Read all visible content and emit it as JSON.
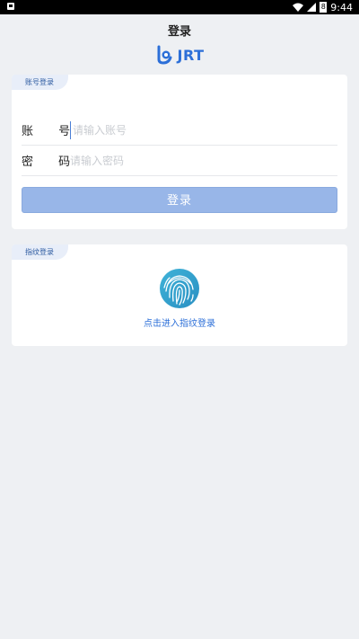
{
  "statusbar": {
    "time": "9:44",
    "battery": "8"
  },
  "header": {
    "title": "登录"
  },
  "logo": {
    "text": "JRT"
  },
  "account_login": {
    "tag": "账号登录",
    "account_label": "账 号",
    "account_placeholder": "请输入账号",
    "password_label": "密 码",
    "password_placeholder": "请输入密码",
    "login_button": "登录"
  },
  "fingerprint_login": {
    "tag": "指纹登录",
    "link_text": "点击进入指纹登录"
  },
  "colors": {
    "accent": "#2c6fd8",
    "button": "#98b6e8",
    "background": "#eef0f3"
  }
}
